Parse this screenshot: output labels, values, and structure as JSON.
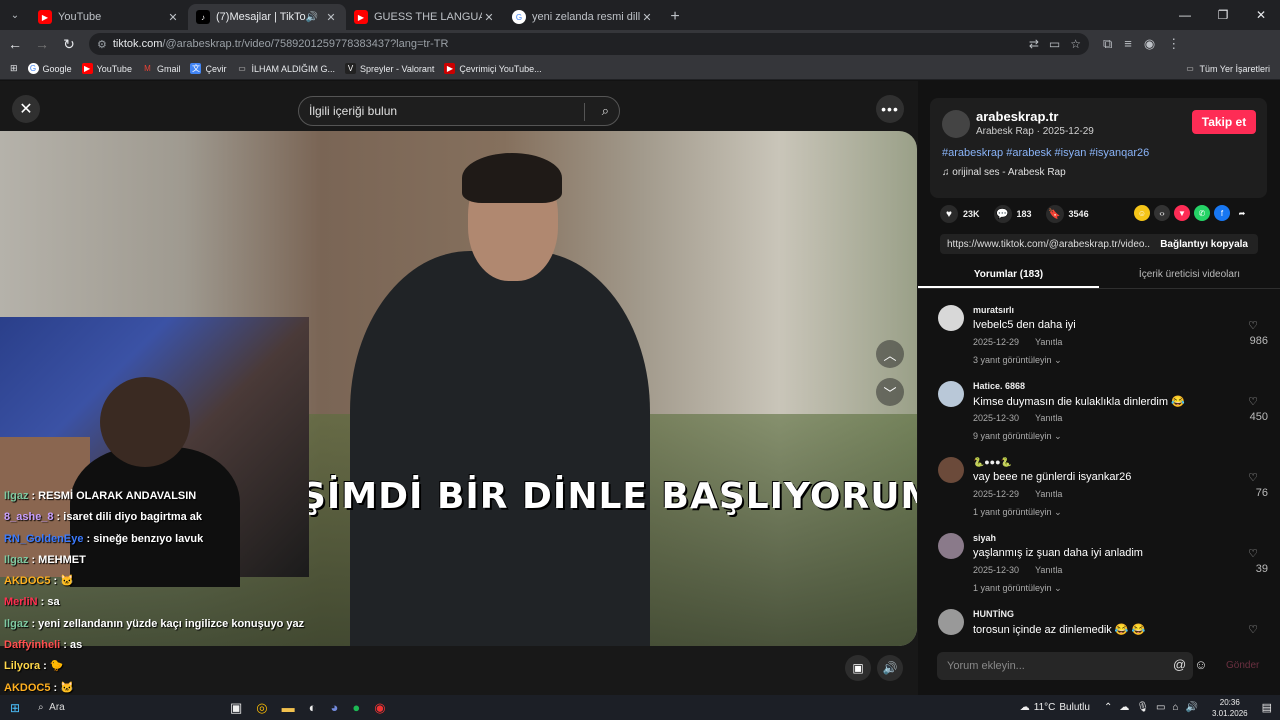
{
  "browser": {
    "tabs": [
      {
        "title": "YouTube",
        "active": false
      },
      {
        "title": "(7)Mesajlar | TikTok",
        "active": true
      },
      {
        "title": "GUESS THE LANGUAGE BY AUD",
        "active": false
      },
      {
        "title": "yeni zelanda resmi dilleri maori",
        "active": false
      }
    ],
    "url_host": "tiktok.com",
    "url_path": "/@arabeskrap.tr/video/7589201259778383437?lang=tr-TR",
    "bookmarks": [
      "Google",
      "YouTube",
      "Gmail",
      "Çevir",
      "İLHAM ALDIĞIM G...",
      "Spreyler - Valorant",
      "Çevrimiçi YouTube..."
    ],
    "bookmarks_all": "Tüm Yer İşaretleri"
  },
  "video": {
    "search_placeholder": "İlgili içeriği bulun",
    "caption": "ŞİMDİ BİR DİNLE BAŞLIYORUM LAY"
  },
  "chat": [
    {
      "user": "Ilgaz",
      "text": ": RESMİ OLARAK ANDAVALSIN",
      "color": "#7ec8a0"
    },
    {
      "user": "8_ashe_8",
      "text": ": isaret dili diyo bagirtma ak",
      "color": "#c9a0ff"
    },
    {
      "user": "RN_GoldenEye",
      "text": ": sineğe benzıyo lavuk",
      "color": "#3b7bff"
    },
    {
      "user": "Ilgaz",
      "text": ": MEHMET",
      "color": "#7ec8a0"
    },
    {
      "user": "AKDOC5",
      "text": ":",
      "color": "#ffb020"
    },
    {
      "user": "MerliN",
      "text": ": sa",
      "color": "#ff3050"
    },
    {
      "user": "Ilgaz",
      "text": ": yeni zellandanın yüzde kaçı ingilizce konuşuyo yaz",
      "color": "#7ec8a0"
    },
    {
      "user": "Daffyinheli",
      "text": ": as",
      "color": "#ff5050"
    },
    {
      "user": "Lilyora",
      "text": ":",
      "color": "#ffd84a"
    },
    {
      "user": "AKDOC5",
      "text": ":",
      "color": "#ffb020"
    }
  ],
  "panel": {
    "author": "arabeskrap.tr",
    "subtitle": "Arabesk Rap · 2025-12-29",
    "follow_label": "Takip et",
    "hashtags": "#arabeskrap #arabesk #isyan #isyanqar26",
    "music": "orijinal ses - Arabesk Rap",
    "likes": "23K",
    "comments_count": "183",
    "saves": "3546",
    "link_url": "https://www.tiktok.com/@arabeskrap.tr/video...",
    "copy_label": "Bağlantıyı kopyala",
    "tab_comments": "Yorumlar (183)",
    "tab_creator": "İçerik üreticisi videoları",
    "comment_placeholder": "Yorum ekleyin...",
    "send_label": "Gönder"
  },
  "comments": [
    {
      "user": "muratsırlı",
      "text": "lvebelc5 den daha iyi",
      "date": "2025-12-29",
      "reply": "Yanıtla",
      "replies": "3 yanıt görüntüleyin",
      "likes": "986"
    },
    {
      "user": "Hatice. 6868",
      "text": "Kimse duymasın die kulaklıkla dinlerdim 😂",
      "date": "2025-12-30",
      "reply": "Yanıtla",
      "replies": "9 yanıt görüntüleyin",
      "likes": "450"
    },
    {
      "user": "🐍●●●🐍",
      "text": "vay beee ne günlerdi isyankar26",
      "date": "2025-12-29",
      "reply": "Yanıtla",
      "replies": "1 yanıt görüntüleyin",
      "likes": "76"
    },
    {
      "user": "siyah",
      "text": "yaşlanmış iz şuan daha iyi anladim",
      "date": "2025-12-30",
      "reply": "Yanıtla",
      "replies": "1 yanıt görüntüleyin",
      "likes": "39"
    },
    {
      "user": "HUNTİNG",
      "text": "torosun içinde az dinlemedik 😂 😂",
      "date": "",
      "reply": "",
      "replies": "",
      "likes": ""
    }
  ],
  "taskbar": {
    "search": "Ara",
    "temp": "11°C",
    "weather": "Bulutlu",
    "time": "20:36",
    "date": "3.01.2026"
  }
}
